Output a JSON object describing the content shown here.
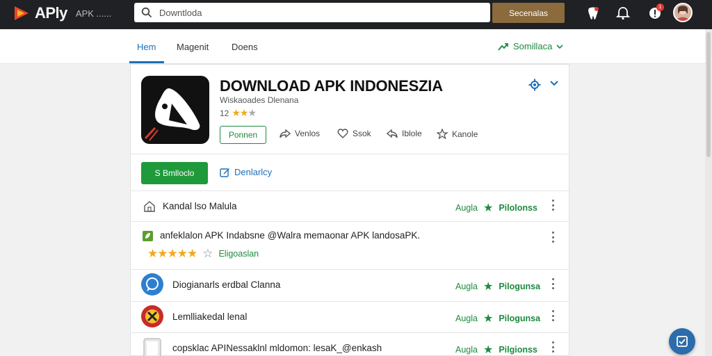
{
  "topbar": {
    "logo_text": "APly",
    "logo_sub": "APK ......",
    "search_placeholder": "Downtloda",
    "search_button": "Secenalas",
    "badge_count": "1"
  },
  "nav": {
    "tabs": [
      {
        "label": "Hem",
        "active": true
      },
      {
        "label": "Magenit",
        "active": false
      },
      {
        "label": "Doens",
        "active": false
      }
    ],
    "similar_label": "Somillaca"
  },
  "app": {
    "title": "DOWNLOAD APK INDONESZIA",
    "developer": "Wiskaoades Dlenana",
    "rating_text": "12",
    "rating_value": 2,
    "open_label": "Ponnen",
    "actions": [
      {
        "label": "Venlos",
        "icon": "share-icon"
      },
      {
        "label": "Ssok",
        "icon": "heart-icon"
      },
      {
        "label": "Iblole",
        "icon": "reply-icon"
      },
      {
        "label": "Kanole",
        "icon": "star-icon"
      }
    ],
    "install_label": "S Bmlloclo",
    "details_label": "Denlarlcy"
  },
  "rows": [
    {
      "icon": "home-icon",
      "text": "Kandal lso Malula",
      "right1": "Augla",
      "right2": "Pilolonss"
    },
    {
      "icon": "leaf-icon",
      "text": "anfeklalon APK Indabsne @Walra memaonar APK landosaPK.",
      "sub": "Eligoaslan",
      "stars": 5,
      "right1": "",
      "right2": ""
    },
    {
      "icon": "chat-icon",
      "text": "Diogianarls erdbal Clanna",
      "right1": "Augla",
      "right2": "Pilogunsa"
    },
    {
      "icon": "game-icon",
      "text": "Lemlliakedal lenal",
      "right1": "Augla",
      "right2": "Pilogunsa"
    },
    {
      "icon": "box-icon",
      "text": "copsklac APINessaklnl mldomon: lesaK_@enkash",
      "right1": "Augla",
      "right2": "Pilgionss"
    }
  ],
  "colors": {
    "accent_blue": "#1d70b8",
    "accent_green": "#1e8a3e",
    "install_green": "#1f9a3b",
    "search_button_brown": "#8b6a3e",
    "topbar_dark": "#1f2124"
  }
}
